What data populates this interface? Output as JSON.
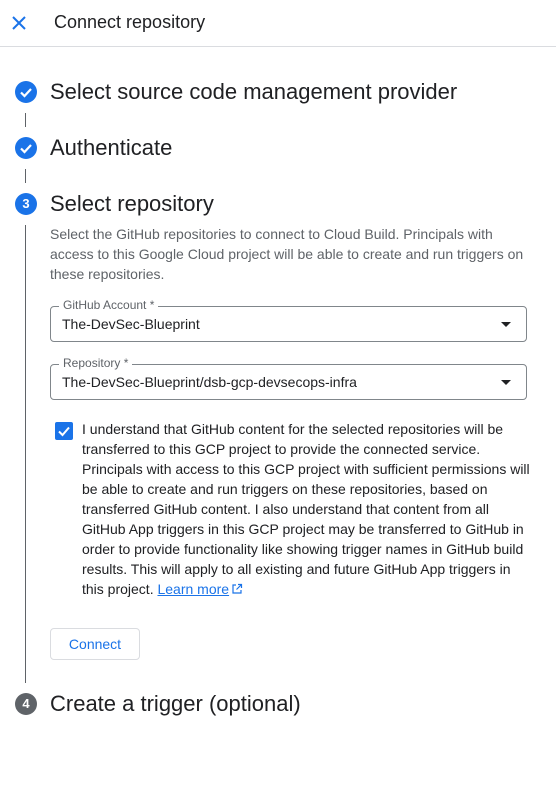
{
  "header": {
    "title": "Connect repository",
    "close_icon": "close-icon"
  },
  "steps": [
    {
      "label": "Select source code management provider",
      "status": "complete"
    },
    {
      "label": "Authenticate",
      "status": "complete"
    },
    {
      "number": "3",
      "label": "Select repository",
      "status": "active"
    },
    {
      "number": "4",
      "label": "Create a trigger (optional)",
      "status": "pending"
    }
  ],
  "select_repository": {
    "description": "Select the GitHub repositories to connect to Cloud Build. Principals with access to this Google Cloud project will be able to create and run triggers on these repositories.",
    "github_account": {
      "label": "GitHub Account *",
      "value": "The-DevSec-Blueprint"
    },
    "repository": {
      "label": "Repository *",
      "value": "The-DevSec-Blueprint/dsb-gcp-devsecops-infra"
    },
    "acknowledgement": {
      "checked": true,
      "text": "I understand that GitHub content for the selected repositories will be transferred to this GCP project to provide the connected service. Principals with access to this GCP project with sufficient permissions will be able to create and run triggers on these repositories, based on transferred GitHub content. I also understand that content from all GitHub App triggers in this GCP project may be transferred to GitHub in order to provide functionality like showing trigger names in GitHub build results. This will apply to all existing and future GitHub App triggers in this project.",
      "learn_more": "Learn more"
    },
    "connect_button": "Connect"
  },
  "colors": {
    "accent": "#1a73e8",
    "pending": "#5f6368",
    "text": "#202124",
    "secondary_text": "#5f6368"
  }
}
